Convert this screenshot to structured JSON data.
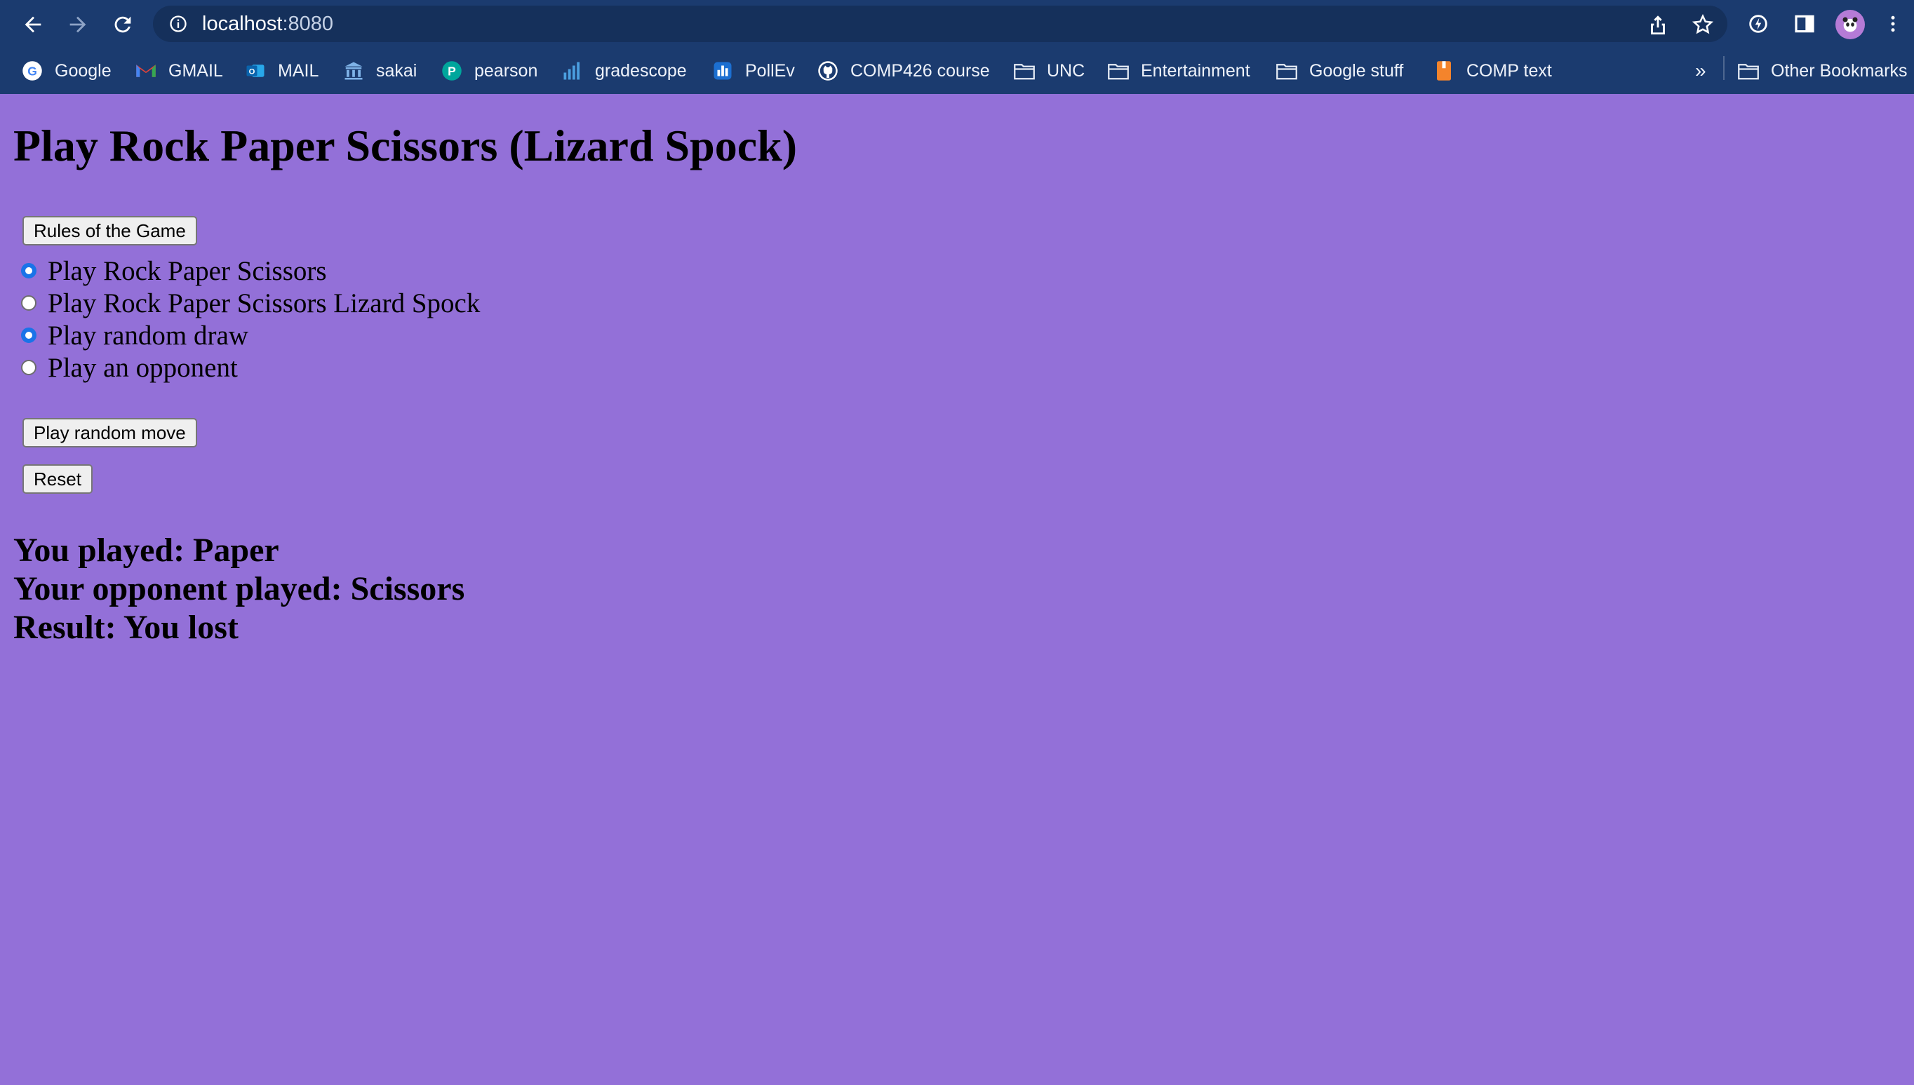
{
  "browser": {
    "url_host": "localhost",
    "url_port": ":8080",
    "bookmarks": [
      {
        "label": "Google",
        "icon": "google-icon"
      },
      {
        "label": "GMAIL",
        "icon": "gmail-icon"
      },
      {
        "label": "MAIL",
        "icon": "outlook-icon"
      },
      {
        "label": "sakai",
        "icon": "sakai-icon"
      },
      {
        "label": "pearson",
        "icon": "pearson-icon"
      },
      {
        "label": "gradescope",
        "icon": "gradescope-icon"
      },
      {
        "label": "PollEv",
        "icon": "pollev-icon"
      },
      {
        "label": "COMP426 course",
        "icon": "github-icon"
      },
      {
        "label": "UNC",
        "icon": "folder-icon"
      },
      {
        "label": "Entertainment",
        "icon": "folder-icon"
      },
      {
        "label": "Google stuff",
        "icon": "folder-icon"
      },
      {
        "label": "COMP text",
        "icon": "book-icon"
      }
    ],
    "overflow_label": "»",
    "other_bookmarks": "Other Bookmarks"
  },
  "page": {
    "title": "Play Rock Paper Scissors (Lizard Spock)",
    "rules_button": "Rules of the Game",
    "options": [
      {
        "label": "Play Rock Paper Scissors",
        "checked": true
      },
      {
        "label": "Play Rock Paper Scissors Lizard Spock",
        "checked": false
      },
      {
        "label": "Play random draw",
        "checked": true
      },
      {
        "label": "Play an opponent",
        "checked": false
      }
    ],
    "play_button": "Play random move",
    "reset_button": "Reset",
    "results": {
      "you_played": "You played: Paper",
      "opponent_played": "Your opponent played: Scissors",
      "result": "Result: You lost"
    }
  },
  "colors": {
    "page_background": "#9370d8",
    "chrome_background": "#1b3b6f",
    "radio_checked": "#1a73e8"
  }
}
